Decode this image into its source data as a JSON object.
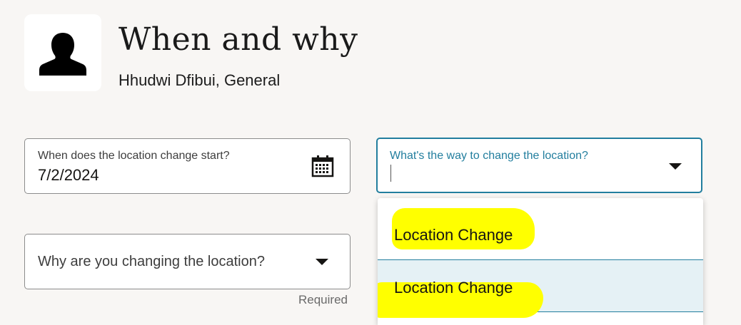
{
  "header": {
    "title": "When and why",
    "subtitle": "Hhudwi Dfibui, General",
    "avatar_icon": "person-silhouette-icon"
  },
  "date_field": {
    "label": "When does the location change start?",
    "value": "7/2/2024",
    "icon": "calendar-icon"
  },
  "way_field": {
    "label": "What's the way to change the location?",
    "value": "",
    "icon": "chevron-down-icon"
  },
  "why_field": {
    "placeholder": "Why are you changing the location?",
    "icon": "chevron-down-icon",
    "required_text": "Required"
  },
  "dropdown": {
    "options": [
      {
        "label": "Location Change"
      },
      {
        "label": "Location Change"
      }
    ],
    "highlight_color": "#ffff00"
  },
  "colors": {
    "accent": "#227e9e",
    "background": "#f8f6f4",
    "selected_option_bg": "#e5f1f5"
  }
}
